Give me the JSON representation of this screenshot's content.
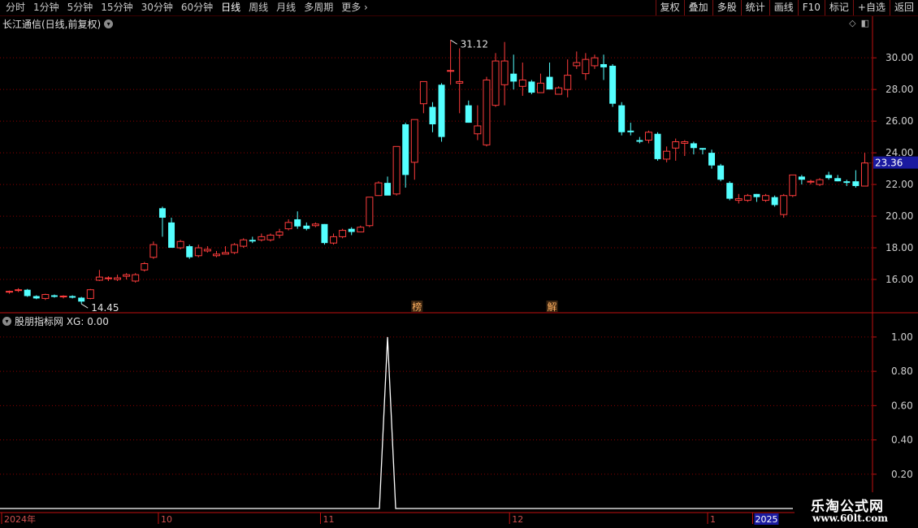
{
  "toolbar": {
    "periods": [
      "分时",
      "1分钟",
      "5分钟",
      "15分钟",
      "30分钟",
      "60分钟",
      "日线",
      "周线",
      "月线",
      "多周期",
      "更多"
    ],
    "active_period": "日线",
    "buttons": [
      "复权",
      "叠加",
      "多股",
      "统计",
      "画线",
      "F10",
      "标记",
      "+自选",
      "返回"
    ]
  },
  "main_chart": {
    "title": "长江通信(日线,前复权)",
    "current_price_label": "23.36",
    "high_label": "31.12",
    "low_label": "14.45",
    "markers": [
      "榜",
      "解"
    ]
  },
  "indicator": {
    "title": "股朋指标网 XG: 0.00"
  },
  "watermark": {
    "line1": "乐淘公式网",
    "line2": "www.60lt.com"
  },
  "colors": {
    "up": "#ff3c3c",
    "down": "#54ffff",
    "grid": "#8b0000",
    "axis": "#c01010",
    "price_box": "#1a1aa0"
  },
  "chart_data": [
    {
      "type": "candlestick",
      "title": "长江通信(日线,前复权)",
      "y_ticks": [
        16.0,
        18.0,
        20.0,
        22.0,
        24.0,
        26.0,
        28.0,
        30.0
      ],
      "ylim": [
        14.0,
        31.6
      ],
      "x_ticks": [
        {
          "label": "2024年",
          "index": 0
        },
        {
          "label": "10",
          "index": 17
        },
        {
          "label": "11",
          "index": 35
        },
        {
          "label": "12",
          "index": 56
        },
        {
          "label": "1",
          "index": 78
        },
        {
          "label": "2025",
          "index": 83
        }
      ],
      "candles": [
        [
          15.2,
          15.3,
          15.1,
          15.25
        ],
        [
          15.3,
          15.45,
          15.2,
          15.35
        ],
        [
          15.35,
          15.4,
          14.9,
          14.95
        ],
        [
          14.95,
          15.0,
          14.75,
          14.8
        ],
        [
          14.8,
          15.1,
          14.7,
          15.05
        ],
        [
          15.0,
          15.05,
          14.85,
          14.9
        ],
        [
          14.9,
          15.0,
          14.8,
          14.95
        ],
        [
          14.95,
          15.0,
          14.8,
          14.85
        ],
        [
          14.85,
          14.9,
          14.45,
          14.6
        ],
        [
          14.8,
          15.4,
          14.75,
          15.35
        ],
        [
          15.95,
          16.6,
          15.9,
          16.15
        ],
        [
          16.05,
          16.2,
          15.9,
          16.1
        ],
        [
          16.0,
          16.3,
          15.9,
          16.1
        ],
        [
          16.2,
          16.4,
          16.0,
          16.3
        ],
        [
          15.9,
          16.4,
          15.8,
          16.3
        ],
        [
          16.6,
          17.1,
          16.5,
          17.0
        ],
        [
          17.4,
          18.4,
          17.3,
          18.2
        ],
        [
          20.5,
          20.6,
          18.7,
          19.9
        ],
        [
          19.6,
          19.9,
          18.0,
          18.0
        ],
        [
          18.0,
          18.5,
          17.9,
          18.4
        ],
        [
          18.1,
          18.2,
          17.3,
          17.4
        ],
        [
          17.5,
          18.2,
          17.4,
          18.0
        ],
        [
          17.8,
          18.1,
          17.7,
          17.9
        ],
        [
          17.5,
          17.8,
          17.4,
          17.6
        ],
        [
          17.6,
          18.1,
          17.6,
          17.7
        ],
        [
          17.7,
          18.3,
          17.6,
          18.2
        ],
        [
          18.1,
          18.6,
          18.0,
          18.5
        ],
        [
          18.5,
          18.7,
          18.3,
          18.4
        ],
        [
          18.5,
          18.9,
          18.4,
          18.7
        ],
        [
          18.5,
          18.9,
          18.4,
          18.8
        ],
        [
          18.8,
          19.2,
          18.6,
          19.0
        ],
        [
          19.2,
          19.8,
          19.1,
          19.6
        ],
        [
          19.8,
          20.3,
          19.2,
          19.35
        ],
        [
          19.4,
          19.6,
          19.1,
          19.2
        ],
        [
          19.4,
          19.6,
          19.3,
          19.5
        ],
        [
          19.5,
          19.5,
          18.2,
          18.3
        ],
        [
          18.3,
          18.9,
          18.2,
          18.7
        ],
        [
          18.7,
          19.2,
          18.6,
          19.1
        ],
        [
          19.2,
          19.3,
          18.8,
          19.0
        ],
        [
          19.0,
          19.4,
          19.0,
          19.3
        ],
        [
          19.4,
          21.2,
          19.3,
          21.2
        ],
        [
          21.3,
          22.2,
          21.6,
          22.1
        ],
        [
          22.1,
          22.5,
          21.7,
          21.3
        ],
        [
          21.4,
          24.4,
          21.3,
          24.4
        ],
        [
          25.8,
          25.9,
          21.8,
          22.6
        ],
        [
          23.4,
          26.1,
          22.3,
          26.1
        ],
        [
          27.1,
          28.5,
          26.5,
          28.5
        ],
        [
          26.9,
          27.2,
          25.3,
          25.8
        ],
        [
          28.3,
          28.4,
          24.7,
          25.0
        ],
        [
          29.2,
          31.12,
          28.3,
          29.2
        ],
        [
          28.4,
          30.6,
          26.5,
          28.5
        ],
        [
          27.0,
          27.3,
          25.9,
          25.9
        ],
        [
          25.2,
          27.0,
          24.8,
          25.7
        ],
        [
          24.5,
          28.8,
          24.4,
          28.6
        ],
        [
          27.0,
          30.3,
          26.9,
          29.8
        ],
        [
          28.3,
          31.0,
          27.0,
          29.8
        ],
        [
          29.0,
          30.2,
          28.0,
          28.5
        ],
        [
          28.2,
          29.7,
          27.6,
          28.6
        ],
        [
          28.5,
          28.6,
          27.7,
          27.8
        ],
        [
          27.8,
          29.0,
          27.8,
          28.4
        ],
        [
          28.8,
          29.7,
          28.1,
          28.0
        ],
        [
          27.7,
          28.2,
          27.8,
          28.1
        ],
        [
          28.0,
          29.9,
          27.5,
          28.9
        ],
        [
          29.5,
          30.4,
          29.3,
          29.7
        ],
        [
          29.0,
          30.3,
          28.6,
          29.9
        ],
        [
          29.5,
          30.2,
          29.3,
          30.0
        ],
        [
          29.6,
          30.2,
          28.6,
          29.4
        ],
        [
          29.5,
          29.6,
          26.9,
          27.1
        ],
        [
          27.0,
          27.2,
          25.1,
          25.3
        ],
        [
          25.4,
          25.9,
          25.1,
          25.3
        ],
        [
          24.8,
          25.0,
          24.6,
          24.7
        ],
        [
          24.8,
          25.4,
          24.6,
          25.3
        ],
        [
          25.2,
          25.3,
          23.5,
          23.6
        ],
        [
          23.6,
          24.4,
          23.4,
          24.1
        ],
        [
          24.3,
          24.9,
          23.5,
          24.7
        ],
        [
          24.6,
          24.8,
          23.8,
          24.7
        ],
        [
          24.6,
          24.7,
          23.9,
          24.3
        ],
        [
          24.3,
          24.3,
          23.9,
          24.2
        ],
        [
          24.0,
          24.2,
          23.0,
          23.2
        ],
        [
          23.2,
          23.3,
          22.2,
          22.3
        ],
        [
          22.1,
          22.2,
          21.0,
          21.1
        ],
        [
          21.0,
          21.4,
          20.8,
          21.1
        ],
        [
          21.0,
          21.4,
          20.9,
          21.3
        ],
        [
          21.4,
          21.4,
          20.9,
          21.2
        ],
        [
          21.0,
          21.4,
          20.9,
          21.3
        ],
        [
          21.2,
          21.3,
          20.6,
          20.7
        ],
        [
          20.1,
          21.4,
          19.9,
          21.3
        ],
        [
          21.3,
          22.6,
          21.2,
          22.6
        ],
        [
          22.5,
          22.6,
          22.0,
          22.3
        ],
        [
          22.2,
          22.3,
          22.0,
          22.2
        ],
        [
          22.0,
          22.4,
          21.9,
          22.3
        ],
        [
          22.6,
          22.8,
          22.3,
          22.4
        ],
        [
          22.4,
          22.6,
          22.2,
          22.2
        ],
        [
          22.2,
          22.3,
          21.9,
          22.1
        ],
        [
          22.2,
          22.9,
          21.8,
          21.9
        ],
        [
          21.9,
          24.0,
          21.9,
          23.36
        ]
      ]
    },
    {
      "type": "line",
      "title": "股朋指标网 XG: 0.00",
      "series": [
        {
          "name": "XG",
          "spike_index": 42,
          "spike_value": 1.0,
          "baseline": 0.0
        }
      ],
      "y_ticks": [
        0.2,
        0.4,
        0.6,
        0.8,
        1.0
      ],
      "ylim": [
        0,
        1.08
      ]
    }
  ]
}
